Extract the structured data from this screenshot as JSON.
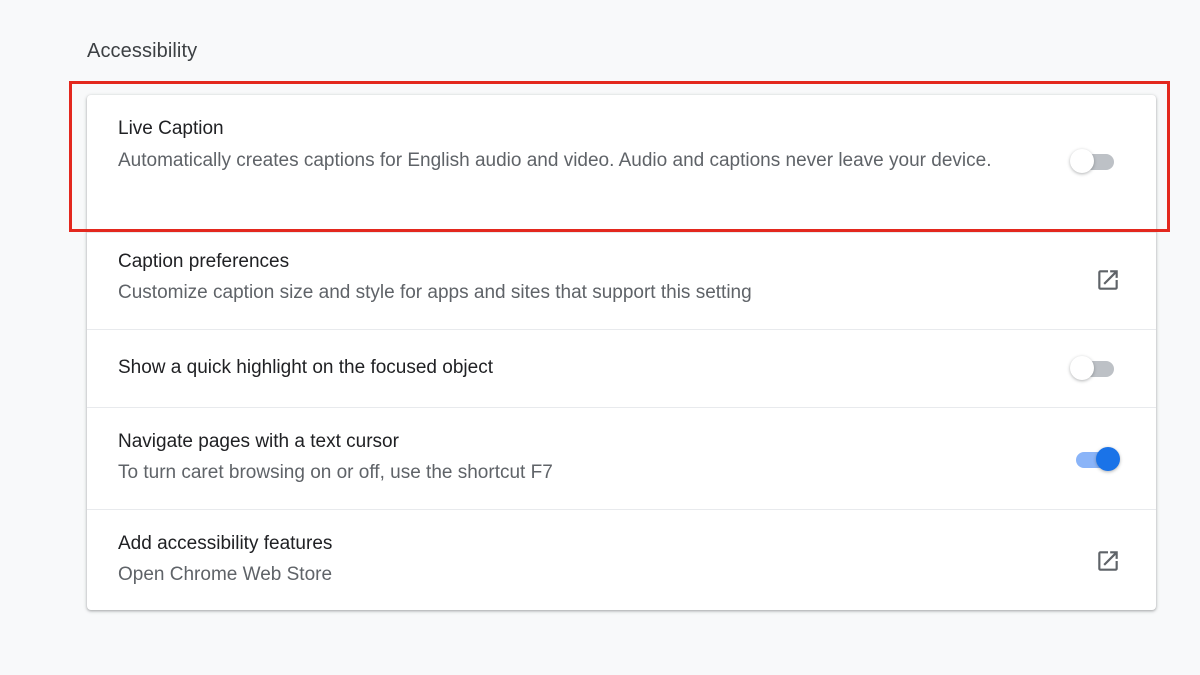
{
  "section": {
    "title": "Accessibility"
  },
  "settings": [
    {
      "title": "Live Caption",
      "description": "Automatically creates captions for English audio and video. Audio and captions never leave your device.",
      "control": "toggle",
      "enabled": false
    },
    {
      "title": "Caption preferences",
      "description": "Customize caption size and style for apps and sites that support this setting",
      "control": "external-link-icon"
    },
    {
      "title": "Show a quick highlight on the focused object",
      "description": "",
      "control": "toggle",
      "enabled": false
    },
    {
      "title": "Navigate pages with a text cursor",
      "description": "To turn caret browsing on or off, use the shortcut F7",
      "control": "toggle",
      "enabled": true
    },
    {
      "title": "Add accessibility features",
      "description": "Open Chrome Web Store",
      "control": "external-link-icon"
    }
  ],
  "colors": {
    "accent": "#1a73e8",
    "accent_track": "#8ab4f8",
    "highlight_border": "#e3281e",
    "title_text": "#202124",
    "secondary_text": "#5f6368"
  }
}
